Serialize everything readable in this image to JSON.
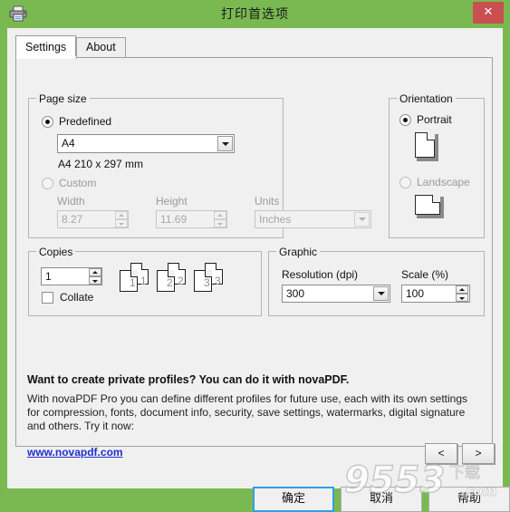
{
  "window": {
    "title": "打印首选项",
    "printer_icon": "printer-icon",
    "close_label": "✕"
  },
  "tabs": [
    {
      "id": "settings",
      "label": "Settings",
      "active": true
    },
    {
      "id": "about",
      "label": "About",
      "active": false
    }
  ],
  "page_size": {
    "group_title": "Page size",
    "predefined_label": "Predefined",
    "predefined_selected": true,
    "paper_value": "A4",
    "paper_description": "A4 210 x 297 mm",
    "custom_label": "Custom",
    "custom_selected": false,
    "width_label": "Width",
    "width_value": "8.27",
    "height_label": "Height",
    "height_value": "11.69",
    "units_label": "Units",
    "units_value": "Inches"
  },
  "orientation": {
    "group_title": "Orientation",
    "portrait_label": "Portrait",
    "portrait_selected": true,
    "landscape_label": "Landscape",
    "landscape_selected": false
  },
  "copies": {
    "group_title": "Copies",
    "count_value": "1",
    "collate_label": "Collate",
    "collate_checked": false,
    "preview_numbers": [
      "1",
      "2",
      "3"
    ]
  },
  "graphic": {
    "group_title": "Graphic",
    "resolution_label": "Resolution (dpi)",
    "resolution_value": "300",
    "scale_label": "Scale (%)",
    "scale_value": "100"
  },
  "promo": {
    "title": "Want to create private profiles? You can do it with novaPDF.",
    "body": "With novaPDF Pro you can define different profiles for future use, each with its own settings for compression, fonts, document info, security, save settings, watermarks, digital signature and others. Try it now:",
    "link": "www.novapdf.com",
    "prev_label": "<",
    "next_label": ">"
  },
  "buttons": {
    "ok": "确定",
    "cancel": "取消",
    "help": "帮助"
  },
  "watermark": {
    "main": "9553",
    "suffix": "下载",
    "domain": ".com"
  },
  "colors": {
    "titlebar_green": "#7ab951",
    "close_red": "#c9504e",
    "dialog_bg": "#f0f0f0",
    "link_blue": "#1f2fd0",
    "focus_blue": "#2f9fe8"
  }
}
